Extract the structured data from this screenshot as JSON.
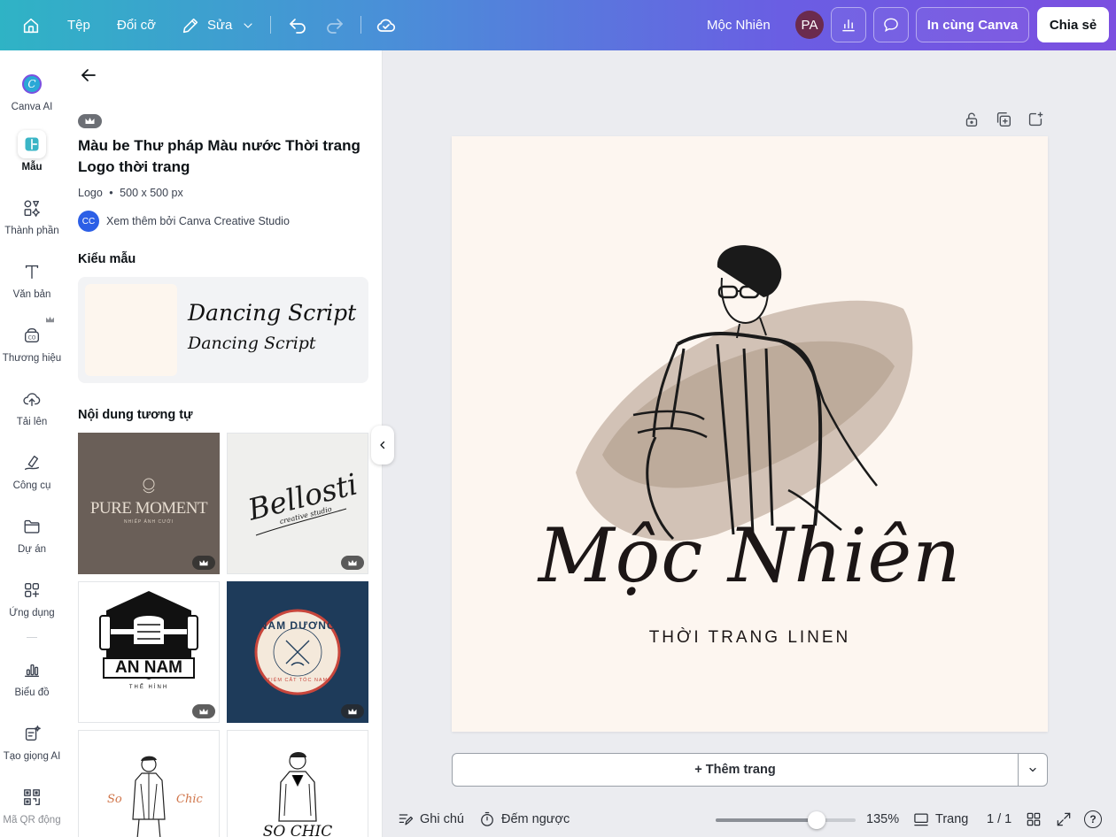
{
  "topbar": {
    "file_label": "Tệp",
    "resize_label": "Đổi cỡ",
    "edit_label": "Sửa",
    "design_name": "Mộc Nhiên",
    "avatar_initials": "PA",
    "print_label": "In cùng Canva",
    "share_label": "Chia sẻ"
  },
  "rail": {
    "items": [
      {
        "label": "Canva AI",
        "icon": "canva-ai-icon"
      },
      {
        "label": "Mẫu",
        "icon": "templates-icon"
      },
      {
        "label": "Thành phần",
        "icon": "elements-icon"
      },
      {
        "label": "Văn bản",
        "icon": "text-icon"
      },
      {
        "label": "Thương hiệu",
        "icon": "brand-icon"
      },
      {
        "label": "Tải lên",
        "icon": "upload-icon"
      },
      {
        "label": "Công cụ",
        "icon": "tools-icon"
      },
      {
        "label": "Dự án",
        "icon": "folder-icon"
      },
      {
        "label": "Ứng dụng",
        "icon": "apps-icon"
      },
      {
        "label": "Biểu đồ",
        "icon": "chart-icon"
      },
      {
        "label": "Tạo giọng AI",
        "icon": "ai-voice-icon"
      },
      {
        "label": "Mã QR động",
        "icon": "qr-icon"
      }
    ]
  },
  "panel": {
    "title": "Màu be Thư pháp Màu nước Thời trang Logo thời trang",
    "meta_type": "Logo",
    "meta_size": "500 x 500 px",
    "creator_initials": "CC",
    "creator_link": "Xem thêm bởi Canva Creative Studio",
    "style_heading": "Kiểu mẫu",
    "font_primary": "Dancing Script",
    "font_secondary": "Dancing Script",
    "similar_heading": "Nội dung tương tự",
    "thumbs": [
      {
        "title": "PURE MOMENT",
        "subtitle": "NHIẾP ẢNH CƯỚI",
        "bg": "#6a5f58"
      },
      {
        "title": "Bellosti",
        "subtitle": "creative studio",
        "bg": "#efefed"
      },
      {
        "title": "AN NAM",
        "subtitle": "THỂ HÌNH",
        "bg": "#ffffff"
      },
      {
        "title": "NAM DƯƠNG",
        "subtitle": "TIỆM CẮT TÓC NAM",
        "bg": "#1e3b5a"
      },
      {
        "title_left": "So",
        "title_right": "Chic",
        "bg": "#ffffff"
      },
      {
        "title": "SO CHIC",
        "bg": "#ffffff"
      }
    ]
  },
  "canvas": {
    "brand_name": "Mộc Nhiên",
    "tagline": "THỜI TRANG LINEN"
  },
  "add_page_label": "+ Thêm trang",
  "bottombar": {
    "notes_label": "Ghi chú",
    "timer_label": "Đếm ngược",
    "zoom": "135%",
    "zoom_fraction": 0.72,
    "pages_label": "Trang",
    "page_count": "1 / 1",
    "help_label": "?"
  }
}
